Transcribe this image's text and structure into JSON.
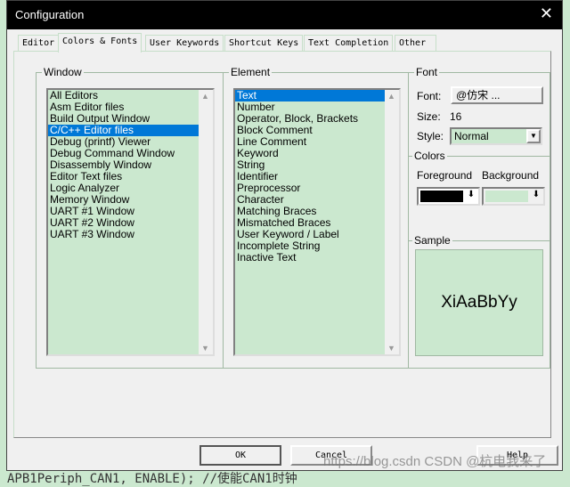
{
  "dialog": {
    "title": "Configuration"
  },
  "tabs": [
    {
      "label": "Editor"
    },
    {
      "label": "Colors & Fonts"
    },
    {
      "label": "User Keywords"
    },
    {
      "label": "Shortcut Keys"
    },
    {
      "label": "Text Completion"
    },
    {
      "label": "Other"
    }
  ],
  "window_group": {
    "label": "Window",
    "items": [
      "All Editors",
      "Asm Editor files",
      "Build Output Window",
      "C/C++ Editor files",
      "Debug (printf) Viewer",
      "Debug Command Window",
      "Disassembly Window",
      "Editor Text files",
      "Logic Analyzer",
      "Memory Window",
      "UART #1 Window",
      "UART #2 Window",
      "UART #3 Window"
    ],
    "selected": "C/C++ Editor files"
  },
  "element_group": {
    "label": "Element",
    "items": [
      "Text",
      "Number",
      "Operator, Block, Brackets",
      "Block Comment",
      "Line Comment",
      "Keyword",
      "String",
      "Identifier",
      "Preprocessor",
      "Character",
      "Matching Braces",
      "Mismatched Braces",
      "User Keyword / Label",
      "Incomplete String",
      "Inactive Text"
    ],
    "selected": "Text"
  },
  "font_group": {
    "label": "Font",
    "font_label": "Font:",
    "font_value": "@仿宋 ...",
    "size_label": "Size:",
    "size_value": "16",
    "style_label": "Style:",
    "style_value": "Normal"
  },
  "colors_group": {
    "label": "Colors",
    "foreground_label": "Foreground",
    "background_label": "Background",
    "foreground_color": "#000000",
    "background_color": "#cbe8cf"
  },
  "sample_group": {
    "label": "Sample",
    "text": "XiAaBbYy"
  },
  "buttons": {
    "ok": "OK",
    "cancel": "Cancel",
    "help": "Help"
  },
  "background_code": "APB1Periph_CAN1, ENABLE); //使能CAN1时钟",
  "watermark": "https://blog.csdn CSDN @杭电我来了"
}
